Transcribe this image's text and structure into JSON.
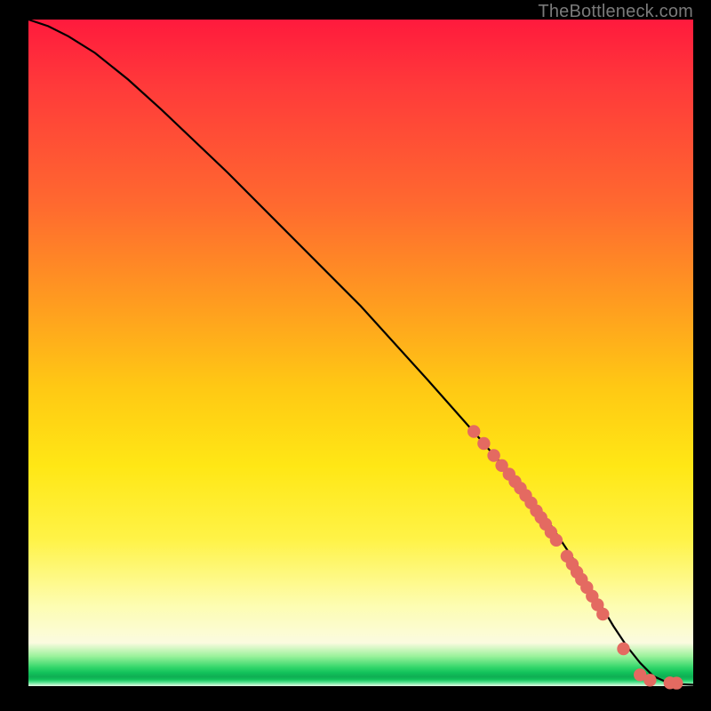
{
  "watermark": "TheBottleneck.com",
  "chart_data": {
    "type": "line",
    "title": "",
    "xlabel": "",
    "ylabel": "",
    "xlim": [
      0,
      100
    ],
    "ylim": [
      0,
      100
    ],
    "grid": false,
    "series": [
      {
        "name": "curve",
        "x": [
          0,
          3,
          6,
          10,
          15,
          20,
          30,
          40,
          50,
          60,
          68,
          74,
          78,
          82,
          85,
          88,
          90,
          92,
          94,
          96,
          98,
          100
        ],
        "y": [
          100,
          99,
          97.5,
          95,
          91,
          86.5,
          77,
          67,
          57,
          46,
          37,
          30,
          25,
          19,
          14,
          9,
          6,
          3.5,
          1.5,
          0.6,
          0.3,
          0.2
        ]
      }
    ],
    "markers": {
      "name": "highlighted-points",
      "color": "#e46a61",
      "x": [
        67,
        68.5,
        70,
        71.2,
        72.3,
        73.2,
        74,
        74.8,
        75.6,
        76.4,
        77.1,
        77.8,
        78.6,
        79.4,
        81,
        81.8,
        82.5,
        83.2,
        84,
        84.8,
        85.6,
        86.4,
        89.5,
        92,
        93.5,
        96.5,
        97.5
      ],
      "y": [
        38.2,
        36.4,
        34.6,
        33.1,
        31.8,
        30.7,
        29.7,
        28.6,
        27.5,
        26.3,
        25.3,
        24.3,
        23.1,
        21.9,
        19.5,
        18.3,
        17.1,
        16,
        14.8,
        13.5,
        12.2,
        10.8,
        5.6,
        1.7,
        0.9,
        0.5,
        0.45
      ]
    },
    "background_gradient": {
      "direction": "vertical",
      "stops": [
        {
          "pos": 0.0,
          "color": "#ff1a3d"
        },
        {
          "pos": 0.42,
          "color": "#ff9a20"
        },
        {
          "pos": 0.67,
          "color": "#ffe715"
        },
        {
          "pos": 0.93,
          "color": "#fbfbe0"
        },
        {
          "pos": 0.97,
          "color": "#32d66a"
        },
        {
          "pos": 1.0,
          "color": "#e7fbe6"
        }
      ]
    }
  }
}
